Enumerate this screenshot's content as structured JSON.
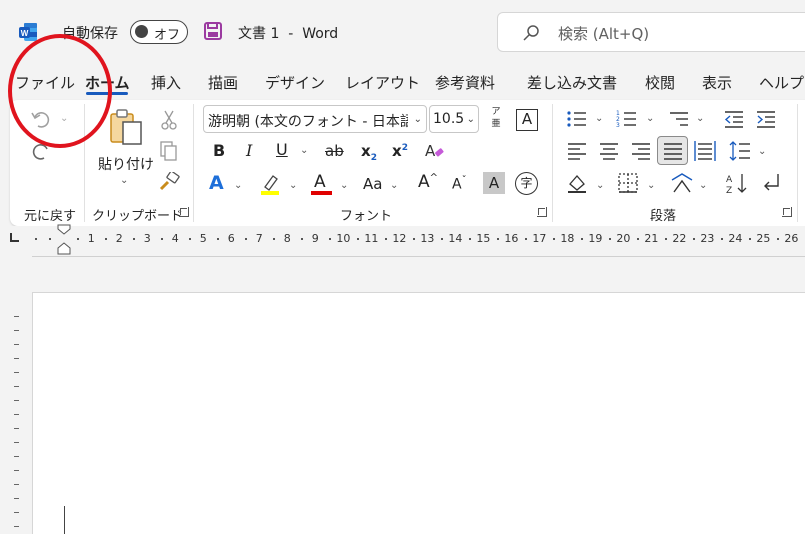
{
  "titlebar": {
    "app_icon": "word-icon",
    "autosave_label": "自動保存",
    "autosave_state": "オフ",
    "save_icon": "save-icon",
    "doc_title": "文書 1  -  Word",
    "search_placeholder": "検索 (Alt+Q)"
  },
  "tabs": [
    "ファイル",
    "ホーム",
    "挿入",
    "描画",
    "デザイン",
    "レイアウト",
    "参考資料",
    "差し込み文書",
    "校閲",
    "表示",
    "ヘルプ"
  ],
  "active_tab": "ホーム",
  "ribbon": {
    "undo_group": {
      "label": "元に戻す",
      "undo_icon": "undo-icon",
      "redo_icon": "redo-icon"
    },
    "clipboard_group": {
      "label": "クリップボード",
      "paste_label": "貼り付け",
      "cut_icon": "scissors-icon",
      "copy_icon": "copy-icon",
      "format_painter_icon": "format-painter-icon"
    },
    "font_group": {
      "label": "フォント",
      "font_name": "游明朝 (本文のフォント - 日本語",
      "font_size": "10.5",
      "furigana_top": "ア",
      "furigana_bottom": "亜",
      "bold": "B",
      "italic": "I",
      "underline": "U",
      "strike": "ab",
      "subscript": "x",
      "subscript_mark": "2",
      "superscript": "x",
      "superscript_mark": "2",
      "text_effect": "A",
      "highlight_color": "#ffff00",
      "font_color_letter": "A",
      "font_color": "#e00000",
      "change_case": "Aa",
      "grow": "A",
      "shrink": "A",
      "char_shading": "A",
      "enclose_char": "字",
      "char_border": "A"
    },
    "paragraph_group": {
      "label": "段落"
    },
    "accent_color": "#185abd"
  },
  "ruler": {
    "numbers": [
      "1",
      "2",
      "3",
      "4",
      "5",
      "6",
      "7",
      "8",
      "9",
      "10",
      "11",
      "12",
      "13",
      "14",
      "15",
      "16",
      "17",
      "18",
      "19",
      "20",
      "21",
      "22",
      "23",
      "24",
      "25",
      "26"
    ]
  }
}
